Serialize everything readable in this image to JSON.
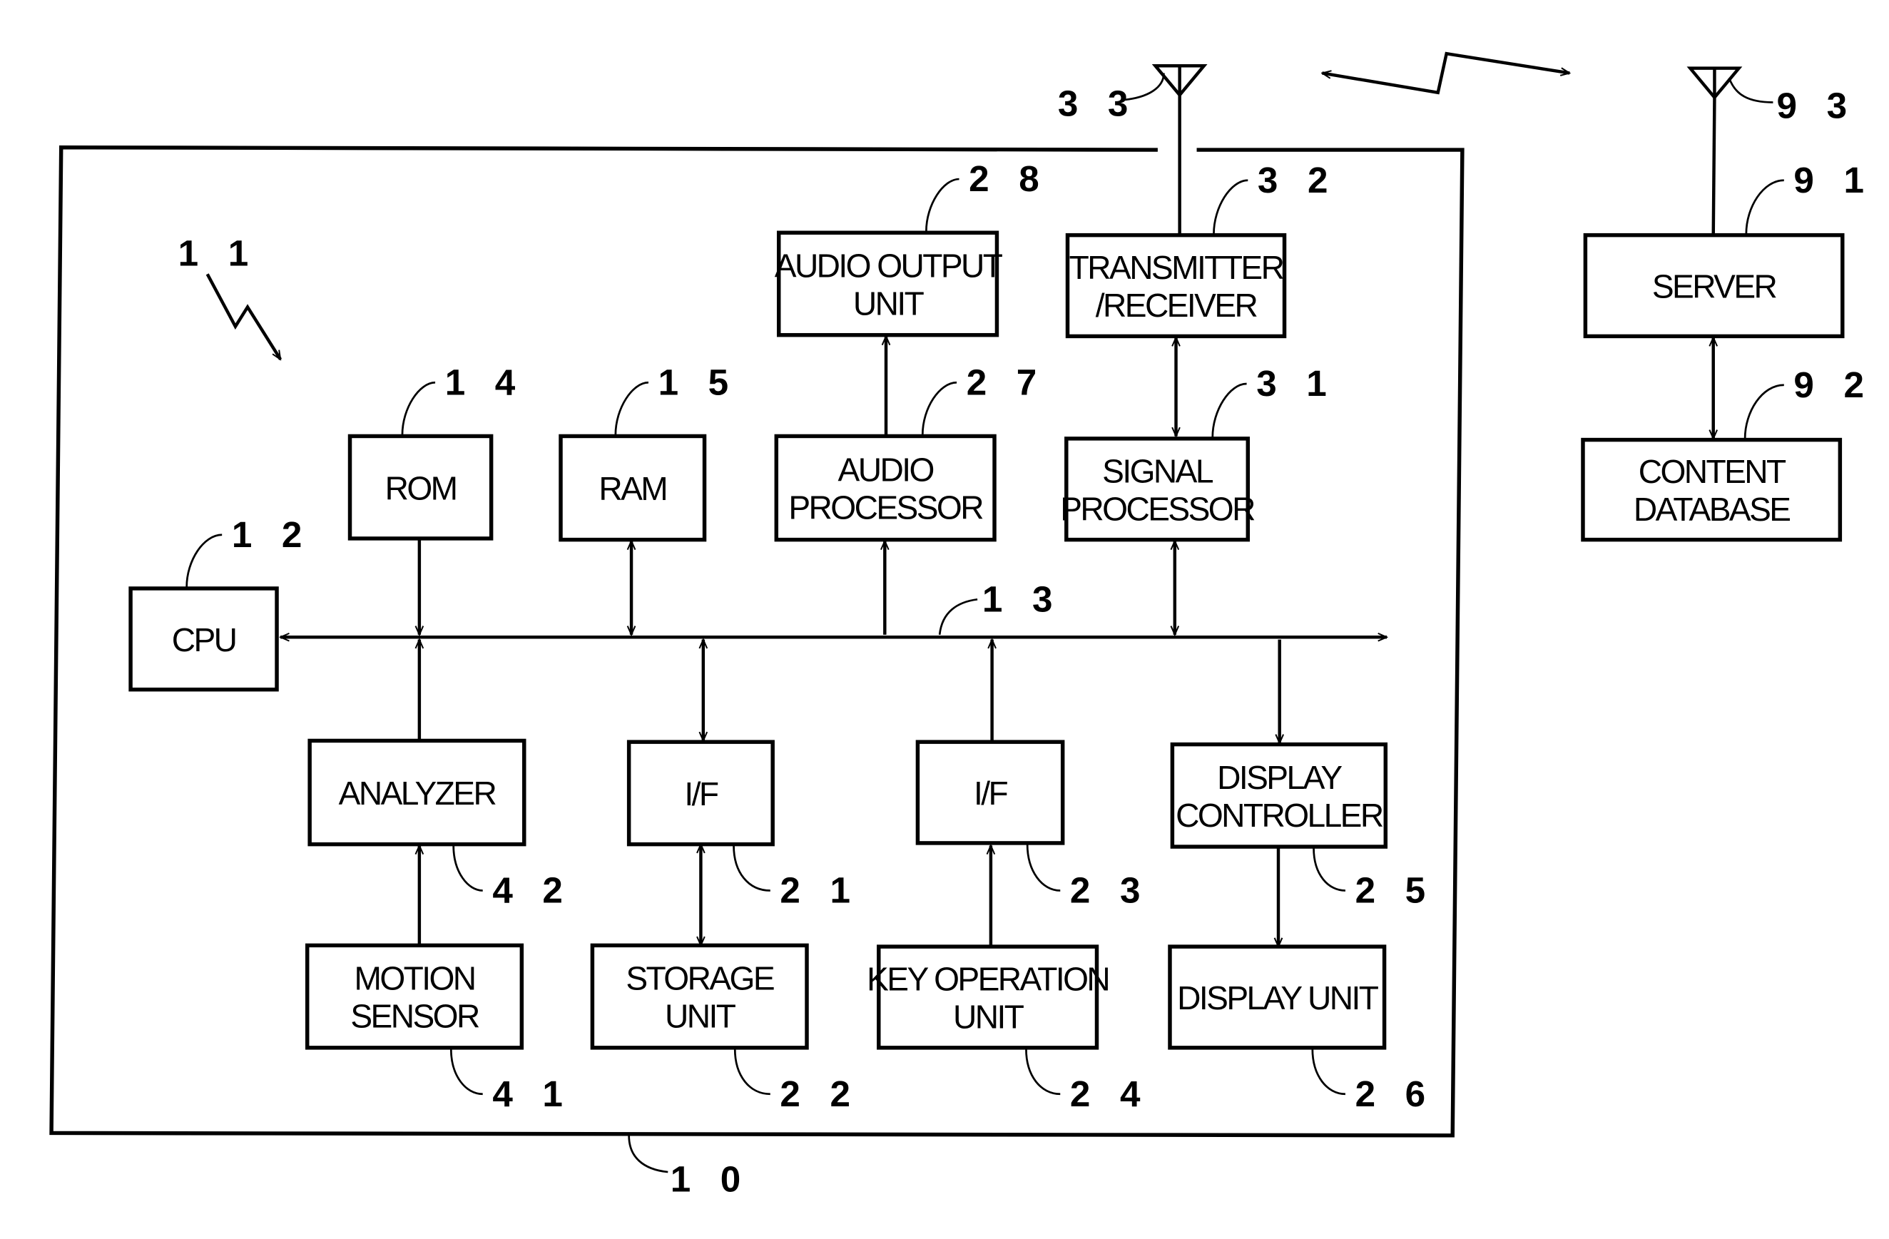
{
  "diagram": {
    "type": "block-diagram",
    "device_ref": "10",
    "device_arrow_ref": "11",
    "bus_ref": "13",
    "blocks": [
      {
        "id": "cpu",
        "ref": "12",
        "lines": [
          "CPU"
        ]
      },
      {
        "id": "rom",
        "ref": "14",
        "lines": [
          "ROM"
        ]
      },
      {
        "id": "ram",
        "ref": "15",
        "lines": [
          "RAM"
        ]
      },
      {
        "id": "audio_processor",
        "ref": "27",
        "lines": [
          "AUDIO",
          "PROCESSOR"
        ]
      },
      {
        "id": "audio_output",
        "ref": "28",
        "lines": [
          "AUDIO OUTPUT",
          "UNIT"
        ]
      },
      {
        "id": "signal_processor",
        "ref": "31",
        "lines": [
          "SIGNAL",
          "PROCESSOR"
        ]
      },
      {
        "id": "transmitter",
        "ref": "32",
        "lines": [
          "TRANSMITTER",
          "/RECEIVER"
        ]
      },
      {
        "id": "analyzer",
        "ref": "42",
        "lines": [
          "ANALYZER"
        ]
      },
      {
        "id": "motion_sensor",
        "ref": "41",
        "lines": [
          "MOTION",
          "SENSOR"
        ]
      },
      {
        "id": "if_storage",
        "ref": "21",
        "lines": [
          "I/F"
        ]
      },
      {
        "id": "storage",
        "ref": "22",
        "lines": [
          "STORAGE",
          "UNIT"
        ]
      },
      {
        "id": "if_key",
        "ref": "23",
        "lines": [
          "I/F"
        ]
      },
      {
        "id": "key_operation",
        "ref": "24",
        "lines": [
          "KEY OPERATION",
          "UNIT"
        ]
      },
      {
        "id": "display_controller",
        "ref": "25",
        "lines": [
          "DISPLAY",
          "CONTROLLER"
        ]
      },
      {
        "id": "display_unit",
        "ref": "26",
        "lines": [
          "DISPLAY UNIT"
        ]
      },
      {
        "id": "server",
        "ref": "91",
        "lines": [
          "SERVER"
        ]
      },
      {
        "id": "content_db",
        "ref": "92",
        "lines": [
          "CONTENT",
          "DATABASE"
        ]
      }
    ],
    "antennas": [
      {
        "id": "device_antenna",
        "ref": "33"
      },
      {
        "id": "server_antenna",
        "ref": "93"
      }
    ],
    "connections": [
      {
        "from": "bus",
        "to": "cpu",
        "direction": "to"
      },
      {
        "from": "rom",
        "to": "bus",
        "direction": "to"
      },
      {
        "from": "ram",
        "to": "bus",
        "direction": "both"
      },
      {
        "from": "bus",
        "to": "audio_processor",
        "direction": "to"
      },
      {
        "from": "audio_processor",
        "to": "audio_output",
        "direction": "to"
      },
      {
        "from": "signal_processor",
        "to": "bus",
        "direction": "both"
      },
      {
        "from": "transmitter",
        "to": "signal_processor",
        "direction": "both"
      },
      {
        "from": "analyzer",
        "to": "bus",
        "direction": "to"
      },
      {
        "from": "motion_sensor",
        "to": "analyzer",
        "direction": "to"
      },
      {
        "from": "if_storage",
        "to": "bus",
        "direction": "both"
      },
      {
        "from": "storage",
        "to": "if_storage",
        "direction": "both"
      },
      {
        "from": "if_key",
        "to": "bus",
        "direction": "to"
      },
      {
        "from": "key_operation",
        "to": "if_key",
        "direction": "to"
      },
      {
        "from": "bus",
        "to": "display_controller",
        "direction": "to"
      },
      {
        "from": "display_controller",
        "to": "display_unit",
        "direction": "to"
      },
      {
        "from": "server",
        "to": "content_db",
        "direction": "both"
      },
      {
        "from": "device_antenna",
        "to": "server_antenna",
        "direction": "both",
        "medium": "wireless"
      }
    ]
  }
}
